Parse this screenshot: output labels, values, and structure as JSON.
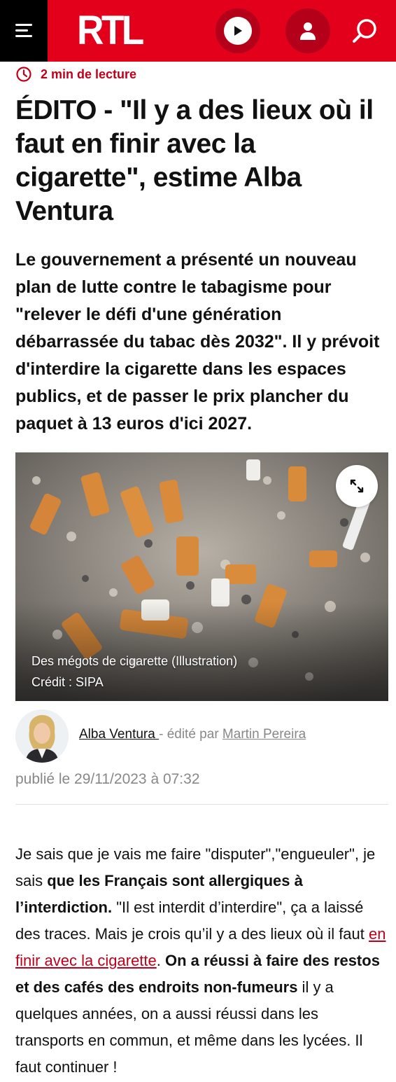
{
  "header": {
    "logo_text": "RTL",
    "brand_color": "#e3001b",
    "icons": [
      "menu-icon",
      "play-icon",
      "user-icon",
      "search-icon"
    ]
  },
  "article": {
    "reading_time": "2 min de lecture",
    "title": "ÉDITO - \"Il y a des lieux où il faut en finir avec la cigarette\", estime Alba Ventura",
    "lead": "Le gouvernement a présenté un nouveau plan de lutte contre le tabagisme pour \"relever le défi d'une génération débarrassée du tabac dès 2032\". Il y prévoit d'interdire la cigarette dans les espaces publics, et de passer le prix plancher du paquet à 13 euros d'ici 2027.",
    "image": {
      "caption": "Des mégots de cigarette (Illustration)",
      "credit": "Crédit : SIPA"
    },
    "author": {
      "name": "Alba Ventura ",
      "edited_by_prefix": " - édité par ",
      "editor": "Martin Pereira"
    },
    "published": "publié le 29/11/2023 à 07:32",
    "body": {
      "p1": "Je sais que je vais me faire \"disputer\",\"engueuler\", je sais ",
      "b1": "que les Français sont allergiques à l’interdiction.",
      "p2": " \"Il est interdit d’interdire\", ça a laissé des traces. Mais je crois qu’il y a des lieux où il faut ",
      "link": "en finir avec la cigarette",
      "p3": ". ",
      "b2": "On a réussi à faire des restos et des cafés des endroits non-fumeurs",
      "p4": " il y a quelques années, on a aussi réussi dans les transports en commun, et même dans les lycées. Il faut continuer !"
    }
  }
}
